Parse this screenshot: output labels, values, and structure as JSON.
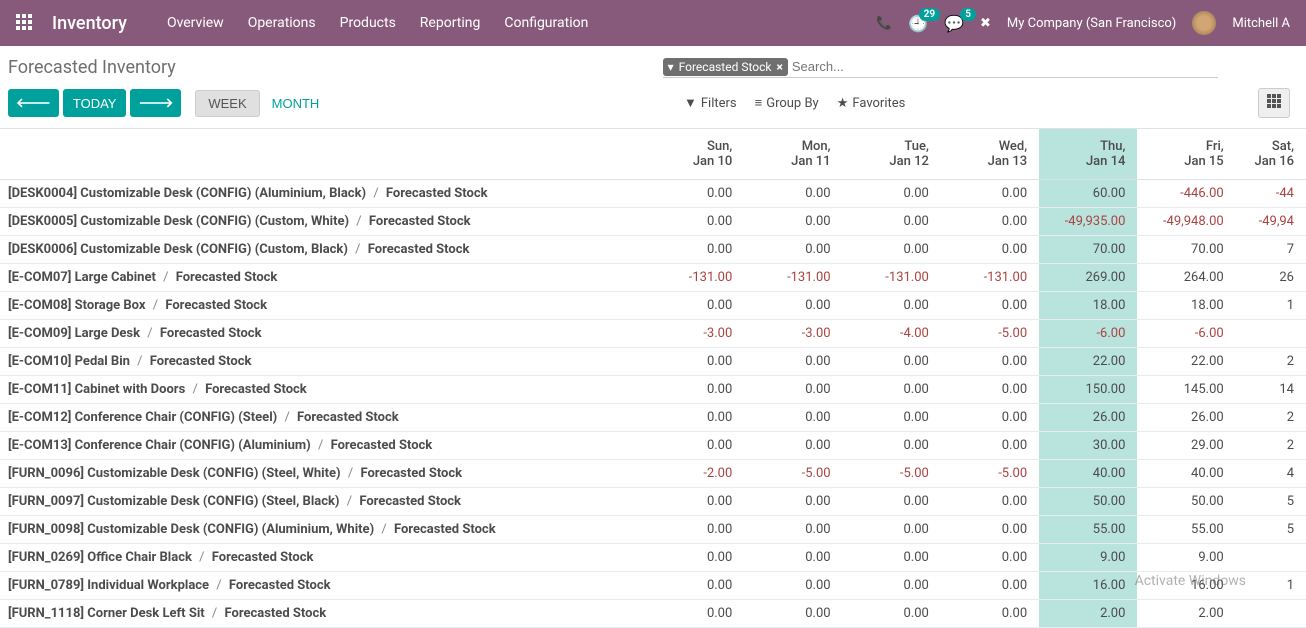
{
  "topbar": {
    "app_title": "Inventory",
    "menu": [
      "Overview",
      "Operations",
      "Products",
      "Reporting",
      "Configuration"
    ],
    "clock_badge": "29",
    "chat_badge": "5",
    "company": "My Company (San Francisco)",
    "user": "Mitchell A"
  },
  "control": {
    "page_title": "Forecasted Inventory",
    "facet_label": "Forecasted Stock",
    "search_placeholder": "Search...",
    "today": "TODAY",
    "scale_week": "WEEK",
    "scale_month": "MONTH",
    "filters": "Filters",
    "groupby": "Group By",
    "favorites": "Favorites"
  },
  "columns": [
    {
      "day": "Sun,",
      "date": "Jan 10"
    },
    {
      "day": "Mon,",
      "date": "Jan 11"
    },
    {
      "day": "Tue,",
      "date": "Jan 12"
    },
    {
      "day": "Wed,",
      "date": "Jan 13"
    },
    {
      "day": "Thu,",
      "date": "Jan 14"
    },
    {
      "day": "Fri,",
      "date": "Jan 15"
    },
    {
      "day": "Sat,",
      "date": "Jan 16"
    }
  ],
  "highlight_col": 4,
  "rows": [
    {
      "product": "[DESK0004] Customizable Desk (CONFIG) (Aluminium, Black)",
      "measure": "Forecasted Stock",
      "values": [
        "0.00",
        "0.00",
        "0.00",
        "0.00",
        "60.00",
        "-446.00",
        "-44"
      ]
    },
    {
      "product": "[DESK0005] Customizable Desk (CONFIG) (Custom, White)",
      "measure": "Forecasted Stock",
      "values": [
        "0.00",
        "0.00",
        "0.00",
        "0.00",
        "-49,935.00",
        "-49,948.00",
        "-49,94"
      ]
    },
    {
      "product": "[DESK0006] Customizable Desk (CONFIG) (Custom, Black)",
      "measure": "Forecasted Stock",
      "values": [
        "0.00",
        "0.00",
        "0.00",
        "0.00",
        "70.00",
        "70.00",
        "7"
      ]
    },
    {
      "product": "[E-COM07] Large Cabinet",
      "measure": "Forecasted Stock",
      "values": [
        "-131.00",
        "-131.00",
        "-131.00",
        "-131.00",
        "269.00",
        "264.00",
        "26"
      ]
    },
    {
      "product": "[E-COM08] Storage Box",
      "measure": "Forecasted Stock",
      "values": [
        "0.00",
        "0.00",
        "0.00",
        "0.00",
        "18.00",
        "18.00",
        "1"
      ]
    },
    {
      "product": "[E-COM09] Large Desk",
      "measure": "Forecasted Stock",
      "values": [
        "-3.00",
        "-3.00",
        "-4.00",
        "-5.00",
        "-6.00",
        "-6.00",
        ""
      ]
    },
    {
      "product": "[E-COM10] Pedal Bin",
      "measure": "Forecasted Stock",
      "values": [
        "0.00",
        "0.00",
        "0.00",
        "0.00",
        "22.00",
        "22.00",
        "2"
      ]
    },
    {
      "product": "[E-COM11] Cabinet with Doors",
      "measure": "Forecasted Stock",
      "values": [
        "0.00",
        "0.00",
        "0.00",
        "0.00",
        "150.00",
        "145.00",
        "14"
      ]
    },
    {
      "product": "[E-COM12] Conference Chair (CONFIG) (Steel)",
      "measure": "Forecasted Stock",
      "values": [
        "0.00",
        "0.00",
        "0.00",
        "0.00",
        "26.00",
        "26.00",
        "2"
      ]
    },
    {
      "product": "[E-COM13] Conference Chair (CONFIG) (Aluminium)",
      "measure": "Forecasted Stock",
      "values": [
        "0.00",
        "0.00",
        "0.00",
        "0.00",
        "30.00",
        "29.00",
        "2"
      ]
    },
    {
      "product": "[FURN_0096] Customizable Desk (CONFIG) (Steel, White)",
      "measure": "Forecasted Stock",
      "values": [
        "-2.00",
        "-5.00",
        "-5.00",
        "-5.00",
        "40.00",
        "40.00",
        "4"
      ]
    },
    {
      "product": "[FURN_0097] Customizable Desk (CONFIG) (Steel, Black)",
      "measure": "Forecasted Stock",
      "values": [
        "0.00",
        "0.00",
        "0.00",
        "0.00",
        "50.00",
        "50.00",
        "5"
      ]
    },
    {
      "product": "[FURN_0098] Customizable Desk (CONFIG) (Aluminium, White)",
      "measure": "Forecasted Stock",
      "values": [
        "0.00",
        "0.00",
        "0.00",
        "0.00",
        "55.00",
        "55.00",
        "5"
      ]
    },
    {
      "product": "[FURN_0269] Office Chair Black",
      "measure": "Forecasted Stock",
      "values": [
        "0.00",
        "0.00",
        "0.00",
        "0.00",
        "9.00",
        "9.00",
        ""
      ]
    },
    {
      "product": "[FURN_0789] Individual Workplace",
      "measure": "Forecasted Stock",
      "values": [
        "0.00",
        "0.00",
        "0.00",
        "0.00",
        "16.00",
        "16.00",
        "1"
      ]
    },
    {
      "product": "[FURN_1118] Corner Desk Left Sit",
      "measure": "Forecasted Stock",
      "values": [
        "0.00",
        "0.00",
        "0.00",
        "0.00",
        "2.00",
        "2.00",
        ""
      ]
    }
  ],
  "watermark": {
    "line1": "Activate Windows",
    "line2": ""
  }
}
